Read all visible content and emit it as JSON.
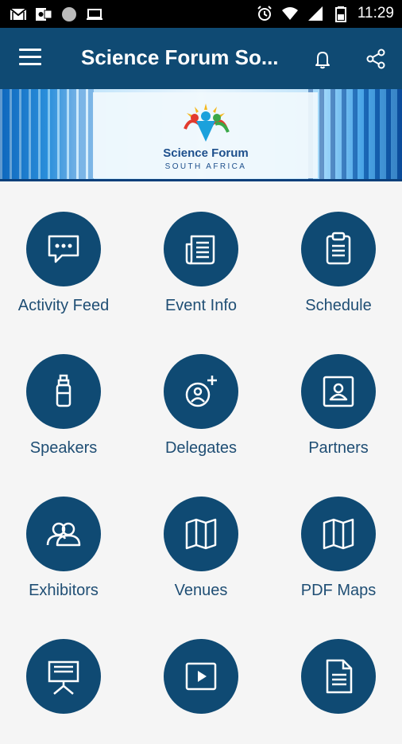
{
  "status_bar": {
    "time": "11:29"
  },
  "app_bar": {
    "title": "Science Forum So..."
  },
  "banner": {
    "logo_title": "Science Forum",
    "logo_subtitle": "SOUTH AFRICA"
  },
  "tiles": [
    {
      "label": "Activity Feed",
      "icon": "chat-bubble-icon"
    },
    {
      "label": "Event Info",
      "icon": "newspaper-icon"
    },
    {
      "label": "Schedule",
      "icon": "clipboard-icon"
    },
    {
      "label": "Speakers",
      "icon": "microphone-icon"
    },
    {
      "label": "Delegates",
      "icon": "add-person-icon"
    },
    {
      "label": "Partners",
      "icon": "portrait-frame-icon"
    },
    {
      "label": "Exhibitors",
      "icon": "people-icon"
    },
    {
      "label": "Venues",
      "icon": "map-icon"
    },
    {
      "label": "PDF Maps",
      "icon": "map-icon"
    },
    {
      "label": "",
      "icon": "presentation-easel-icon"
    },
    {
      "label": "",
      "icon": "video-play-icon"
    },
    {
      "label": "",
      "icon": "document-icon"
    }
  ],
  "colors": {
    "primary": "#0f4a73",
    "label": "#1f4e74",
    "background": "#f5f5f5"
  }
}
